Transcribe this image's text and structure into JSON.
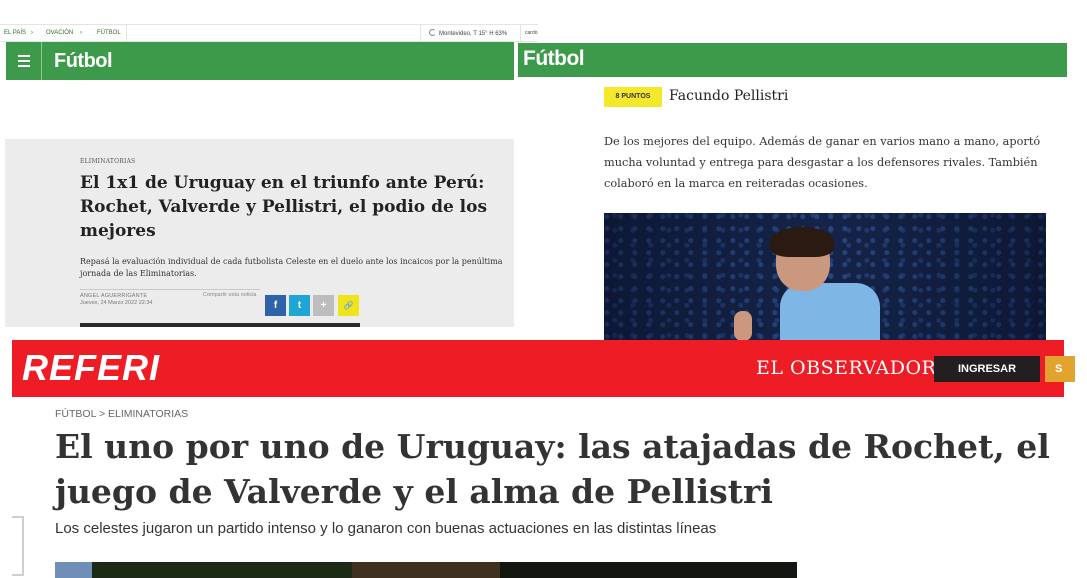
{
  "panel_a": {
    "breadcrumbs": [
      "EL PAÍS",
      "OVACIÓN",
      "FÚTBOL"
    ],
    "separator": "›",
    "weather": "Montevideo, T 15° H 63%",
    "right_text": "cardo",
    "menu_icon": "hamburger-icon",
    "brand": "Fútbol",
    "kicker": "ELIMINATORIAS",
    "title": "El 1x1 de Uruguay en el triunfo ante Perú: Rochet, Valverde y Pellistri, el podio de los mejores",
    "subtitle": "Repasá la evaluación individual de cada futbolista Celeste en el duelo ante los incaicos por la penúltima jornada de las Eliminatorias.",
    "author": "ÁNGEL AGUERRIGANTE",
    "date": "Jueves, 24 Marzo 2022 22:34",
    "share_label": "Compartir esta noticia",
    "share_buttons": {
      "facebook": "f",
      "twitter": "t",
      "plus": "+",
      "link": "🔗"
    },
    "colors": {
      "green": "#3e9a4b",
      "facebook": "#2e63a9",
      "twitter": "#1fa5d6",
      "link": "#efe31a"
    }
  },
  "panel_b": {
    "brand": "Fútbol",
    "badge": "8 PUNTOS",
    "player_name": "Facundo Pellistri",
    "body": "De los mejores del equipo. Además de ganar en varios mano a mano, aportó mucha voluntad y entrega para desgastar a los defensores rivales. También colaboró en la marca en reiteradas ocasiones.",
    "colors": {
      "green": "#3e9a4b",
      "badge": "#f3e82a"
    }
  },
  "panel_c": {
    "logo": "REFERI",
    "partner_logo": "EL OBSERVADOR",
    "login_label": "INGRESAR",
    "subscribe_label": "S",
    "breadcrumb": "FÚTBOL > ELIMINATORIAS",
    "title": "El uno por uno de Uruguay: las atajadas de Rochet, el juego de Valverde y el alma de Pellistri",
    "subtitle": "Los celestes jugaron un partido intenso y lo ganaron con buenas actuaciones en las distintas líneas",
    "colors": {
      "red": "#ee1c25",
      "login": "#231f20",
      "subscribe": "#e3a42f"
    }
  }
}
